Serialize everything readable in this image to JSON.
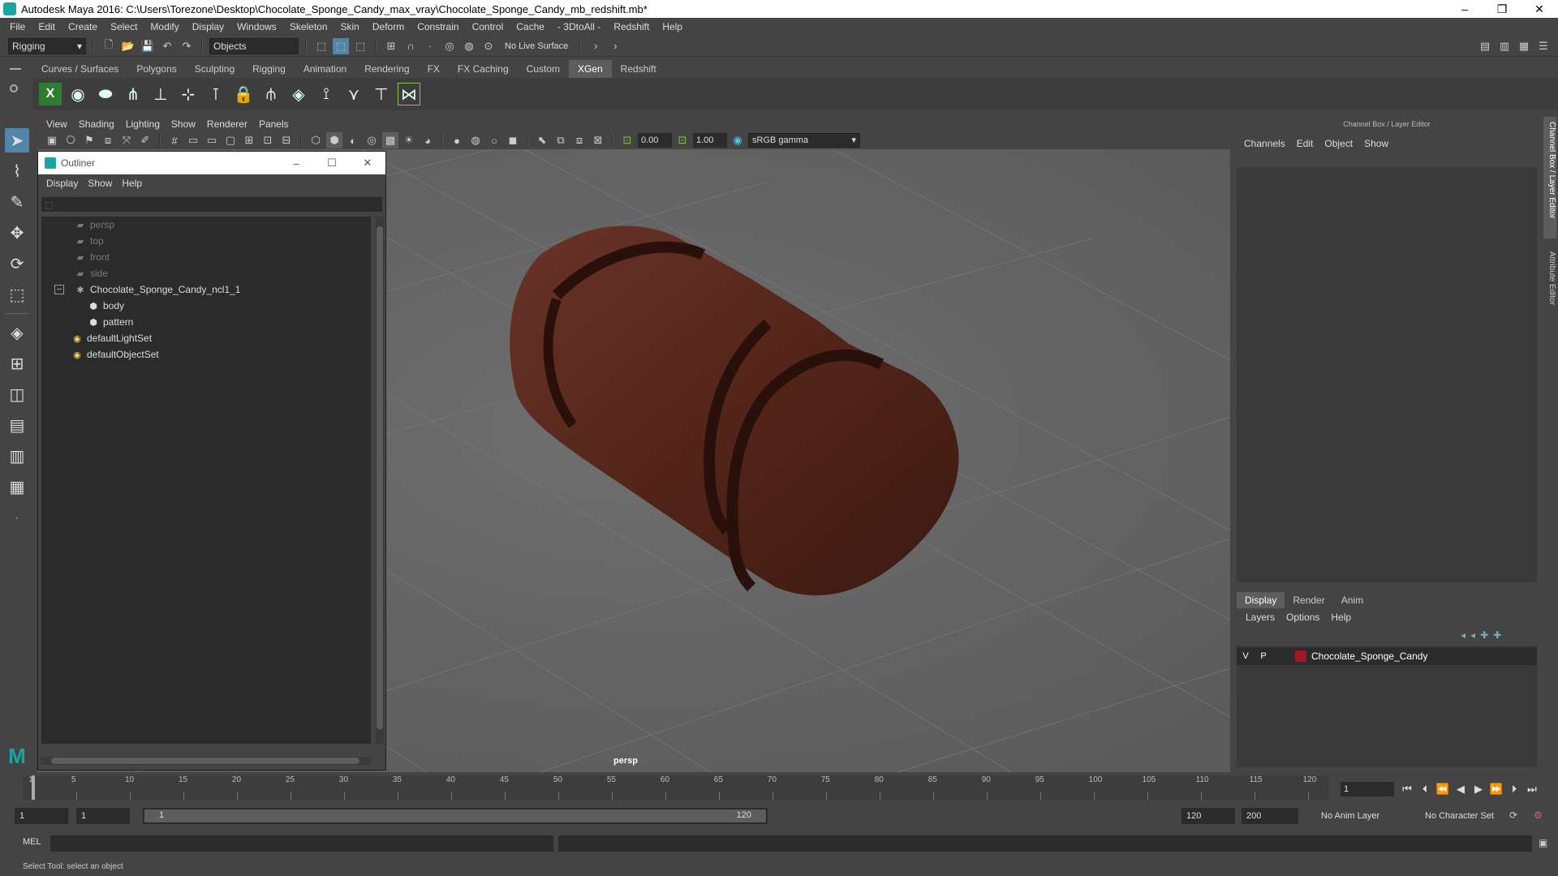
{
  "window": {
    "title": "Autodesk Maya 2016: C:\\Users\\Torezone\\Desktop\\Chocolate_Sponge_Candy_max_vray\\Chocolate_Sponge_Candy_mb_redshift.mb*",
    "minimize": "–",
    "maximize": "❐",
    "close": "✕"
  },
  "menubar": [
    "File",
    "Edit",
    "Create",
    "Select",
    "Modify",
    "Display",
    "Windows",
    "Skeleton",
    "Skin",
    "Deform",
    "Constrain",
    "Control",
    "Cache",
    "- 3DtoAll -",
    "Redshift",
    "Help"
  ],
  "statusline": {
    "menuset": "Rigging",
    "selection_mode": "Objects",
    "live_surface": "No Live Surface"
  },
  "shelf_tabs": [
    "Curves / Surfaces",
    "Polygons",
    "Sculpting",
    "Rigging",
    "Animation",
    "Rendering",
    "FX",
    "FX Caching",
    "Custom",
    "XGen",
    "Redshift"
  ],
  "shelf_active": "XGen",
  "viewport": {
    "menu": [
      "View",
      "Shading",
      "Lighting",
      "Show",
      "Renderer",
      "Panels"
    ],
    "exposure": "0.00",
    "gamma": "1.00",
    "color_space": "sRGB gamma",
    "camera_label": "persp"
  },
  "outliner": {
    "title": "Outliner",
    "menu": [
      "Display",
      "Show",
      "Help"
    ],
    "items": [
      {
        "label": "persp",
        "dim": true,
        "icon": "camera-icon"
      },
      {
        "label": "top",
        "dim": true,
        "icon": "camera-icon"
      },
      {
        "label": "front",
        "dim": true,
        "icon": "camera-icon"
      },
      {
        "label": "side",
        "dim": true,
        "icon": "camera-icon"
      },
      {
        "label": "Chocolate_Sponge_Candy_ncl1_1",
        "dim": false,
        "icon": "group-icon"
      },
      {
        "label": "body",
        "dim": false,
        "icon": "mesh-icon"
      },
      {
        "label": "pattern",
        "dim": false,
        "icon": "mesh-icon"
      },
      {
        "label": "defaultLightSet",
        "dim": false,
        "icon": "set-icon"
      },
      {
        "label": "defaultObjectSet",
        "dim": false,
        "icon": "set-icon"
      }
    ]
  },
  "channelbox": {
    "title": "Channel Box / Layer Editor",
    "menu": [
      "Channels",
      "Edit",
      "Object",
      "Show"
    ],
    "layer_tabs": [
      "Display",
      "Render",
      "Anim"
    ],
    "layer_tab_active": "Display",
    "layer_menu": [
      "Layers",
      "Options",
      "Help"
    ],
    "layer": {
      "v": "V",
      "p": "P",
      "name": "Chocolate_Sponge_Candy",
      "color": "#a01828"
    }
  },
  "side_tabs": [
    "Channel Box / Layer Editor",
    "Attribute Editor"
  ],
  "timeline": {
    "ticks": [
      1,
      5,
      10,
      15,
      20,
      25,
      30,
      35,
      40,
      45,
      50,
      55,
      60,
      65,
      70,
      75,
      80,
      85,
      90,
      95,
      100,
      105,
      110,
      115,
      120
    ],
    "current_frame": "1"
  },
  "range": {
    "start": "1",
    "playback_start": "1",
    "bar_left": "1",
    "bar_right": "120",
    "playback_end": "120",
    "end": "200",
    "anim_layer": "No Anim Layer",
    "character_set": "No Character Set"
  },
  "cmdline": {
    "label": "MEL"
  },
  "helpline": {
    "text": "Select Tool: select an object"
  }
}
